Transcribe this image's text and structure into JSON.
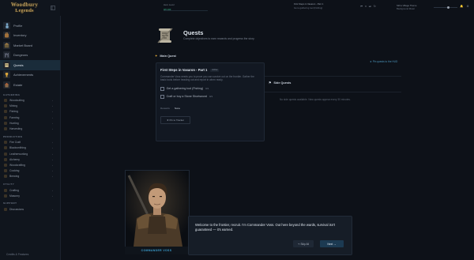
{
  "sidebar": {
    "logo_line1": "Woodbury",
    "logo_line2": "Legends",
    "nav": [
      {
        "label": "Profile"
      },
      {
        "label": "Inventory"
      },
      {
        "label": "Market Board"
      },
      {
        "label": "Dungeons"
      },
      {
        "label": "Quests"
      },
      {
        "label": "Achievements"
      },
      {
        "label": "Estate"
      }
    ],
    "gathering_title": "GATHERING",
    "gathering": [
      {
        "label": "Woodcutting"
      },
      {
        "label": "Mining"
      },
      {
        "label": "Fishing"
      },
      {
        "label": "Farming"
      },
      {
        "label": "Hunting"
      },
      {
        "label": "Harvesting"
      }
    ],
    "production_title": "PRODUCTION",
    "production": [
      {
        "label": "Fire Craft"
      },
      {
        "label": "Blacksmithing"
      },
      {
        "label": "Leatherworking"
      },
      {
        "label": "Alchemy"
      },
      {
        "label": "Woodcrafting"
      },
      {
        "label": "Cooking"
      },
      {
        "label": "Brewing"
      }
    ],
    "utility_title": "UTILITY",
    "utility": [
      {
        "label": "Crafting"
      },
      {
        "label": "Masonry"
      }
    ],
    "support_title": "SUPPORT",
    "support": [
      {
        "label": "Discussions"
      }
    ],
    "footer_link": "Credits & Features"
  },
  "topbar": {
    "meter_label": "Hero Level",
    "meter_vals": "0/0     100",
    "meter_fill": 0,
    "quest_line1": "First Steps in Vasaron - Part 1",
    "quest_line2": "Get a gathering tool (Fishing)",
    "track_title": "Still a Village Theme",
    "track_sub": "Background Music"
  },
  "page": {
    "title": "Quests",
    "subtitle": "Complete objectives to earn rewards and progress the story."
  },
  "main_quest": {
    "label": "Main Quest",
    "title": "First Steps in Vasaron - Part 1",
    "badge": "Active",
    "description": "Commander Voss needs you to prove you can survive out on the frontier. Gather the basic tools before heading out and report in when ready.",
    "objectives": [
      {
        "label": "Get a gathering tool (Fishing)",
        "count": "0/1"
      },
      {
        "label": "Craft or buy a Stone Shortsword",
        "count": "0/1"
      }
    ],
    "reward_label": "Rewards",
    "reward_value": "None",
    "pin_label": "★ Pin to Tracker"
  },
  "pin_hint": "★ Pin quests to the HUD",
  "side_quests": {
    "label": "Side Quests",
    "empty": "No side quests available. New quests appear every 30 minutes."
  },
  "dialogue": {
    "speaker": "COMMANDER VOSS",
    "text": "Welcome to the frontier, recruit. I'm Commander Voss. Out here beyond the wards, survival isn't guaranteed — it's earned.",
    "skip_label": "↷ Skip All",
    "next_label": "Next →"
  },
  "colors": {
    "accent": "#3b9fd0",
    "gold": "#d6a23a",
    "background": "#0d1118",
    "sidebar": "#10151d"
  }
}
